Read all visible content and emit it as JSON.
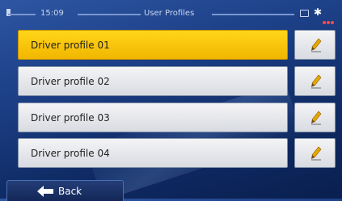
{
  "status_bar": {
    "time": "15:09",
    "title": "User Profiles",
    "icons": [
      "signal-icon",
      "battery-icon",
      "bluetooth-icon",
      "menu-dots-icon"
    ],
    "bluetooth_glyph": "✱"
  },
  "profiles": [
    {
      "label": "Driver profile 01",
      "selected": true
    },
    {
      "label": "Driver profile 02",
      "selected": false
    },
    {
      "label": "Driver profile 03",
      "selected": false
    },
    {
      "label": "Driver profile 04",
      "selected": false
    }
  ],
  "edit_icon": "pencil-icon",
  "footer": {
    "back_label": "Back",
    "back_icon": "arrow-left-icon"
  },
  "colors": {
    "background": "#1c3f86",
    "selected_row": "#f1b600",
    "row": "#e4e6eb",
    "pencil": "#e6a800"
  }
}
